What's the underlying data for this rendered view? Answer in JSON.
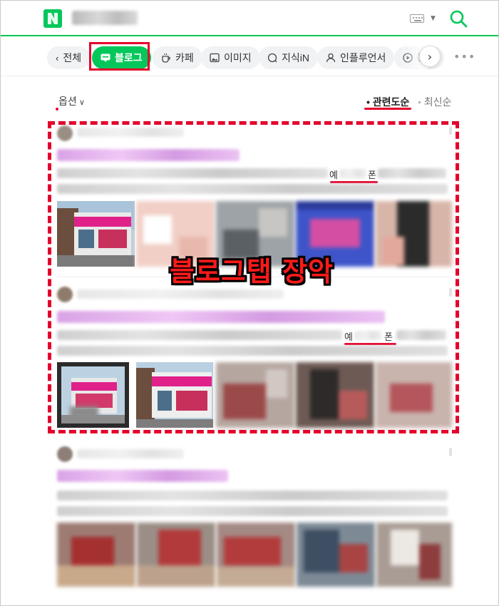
{
  "tabs": {
    "all": "전체",
    "blog": "블로그",
    "cafe": "카페",
    "image": "이미지",
    "kin": "지식iN",
    "influencer": "인플루언서",
    "video_partial": "동"
  },
  "filters": {
    "options_label": "옵션",
    "sort_relevance": "관련도순",
    "sort_latest": "최신순"
  },
  "posts": [
    {
      "keyword_start": "예",
      "keyword_end": "폰"
    },
    {
      "keyword_start": "예",
      "keyword_end": "폰"
    }
  ],
  "annotation": {
    "caption": "블로그탭 장악"
  },
  "colors": {
    "brand_green": "#03c75a",
    "highlight_red": "#e4002b",
    "blurred_title_purple": "#d9a3e6"
  },
  "icons": [
    "naver-logo-icon",
    "keyboard-icon",
    "search-icon",
    "chevron-left-icon",
    "blog-icon",
    "cafe-icon",
    "image-icon",
    "kin-icon",
    "person-icon",
    "play-icon",
    "chevron-right-icon",
    "more-icon"
  ]
}
